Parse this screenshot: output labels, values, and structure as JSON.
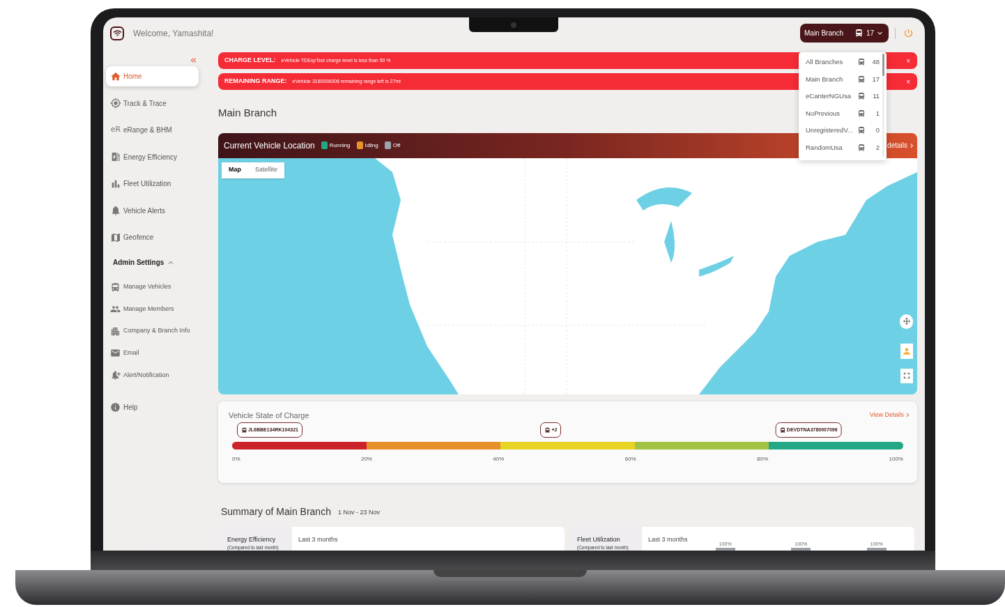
{
  "header": {
    "welcome": "Welcome, Yamashita!",
    "branch_selector": {
      "label": "Main Branch",
      "count": "17"
    }
  },
  "branch_menu": {
    "items": [
      {
        "name": "All Branches",
        "count": "48"
      },
      {
        "name": "Main Branch",
        "count": "17"
      },
      {
        "name": "eCanterNGUsa",
        "count": "11"
      },
      {
        "name": "NoPrevious",
        "count": "1"
      },
      {
        "name": "UnregisteredV...",
        "count": "0"
      },
      {
        "name": "RandomUsa",
        "count": "2"
      }
    ]
  },
  "sidebar": {
    "items": [
      {
        "label": "Home",
        "selected": true
      },
      {
        "label": "Track & Trace",
        "selected": false
      },
      {
        "label": "eRange & BHM",
        "selected": false,
        "icon_text": "eR"
      },
      {
        "label": "Energy Efficiency",
        "selected": false
      },
      {
        "label": "Fleet Utilization",
        "selected": false
      },
      {
        "label": "Vehicle Alerts",
        "selected": false
      },
      {
        "label": "Geofence",
        "selected": false
      }
    ],
    "admin_settings": {
      "label": "Admin Settings",
      "expanded": true,
      "items": [
        {
          "label": "Manage Vehicles"
        },
        {
          "label": "Manage Members"
        },
        {
          "label": "Company & Branch Info"
        },
        {
          "label": "Email"
        },
        {
          "label": "Alert/Notification"
        }
      ]
    },
    "footer_items": [
      {
        "label": "Help"
      }
    ]
  },
  "alerts": [
    {
      "title": "CHARGE LEVEL:",
      "message": "eVehicle TDExpTest charge level is less than 50 %",
      "close": "×"
    },
    {
      "title": "REMAINING RANGE:",
      "message": "eVehicle 3160006008 remaining range left is 27mi",
      "close": "×"
    }
  ],
  "page_title": "Main Branch",
  "location_card": {
    "title": "Current Vehicle Location",
    "legend": [
      {
        "label": "Running",
        "color": "#22a884"
      },
      {
        "label": "Idling",
        "color": "#e8922a"
      },
      {
        "label": "Off",
        "color": "#9ca3af"
      }
    ],
    "details_link": "details",
    "map_types": [
      {
        "label": "Map",
        "selected": true
      },
      {
        "label": "Satellite",
        "selected": false
      }
    ]
  },
  "charge_card": {
    "title": "Vehicle State of Charge",
    "view_details": "View Details",
    "segments": [
      {
        "color": "#cc2229"
      },
      {
        "color": "#e8912a"
      },
      {
        "color": "#e6d324"
      },
      {
        "color": "#a3c244"
      },
      {
        "color": "#22a884"
      }
    ],
    "markers": [
      {
        "label": "JL6BBE134RK104321",
        "level": 0.056
      },
      {
        "label": "+2",
        "level": 0.475
      },
      {
        "label": "DEVDTNA3780007096",
        "level": 0.859
      }
    ],
    "ticks": [
      "0%",
      "20%",
      "40%",
      "60%",
      "80%",
      "100%"
    ]
  },
  "summary": {
    "title": "Summary of Main Branch",
    "date_range": "1 Nov - 23 Nov",
    "cards": [
      {
        "title": "Energy Efficiency",
        "subtitle": "(Compared to last month)",
        "period": "Last 3 months"
      },
      {
        "title": "Fleet Utilization",
        "subtitle": "(Compared to last month)",
        "period": "Last 3 months",
        "chart_labels": [
          "100%",
          "100%",
          "100%"
        ]
      }
    ]
  }
}
